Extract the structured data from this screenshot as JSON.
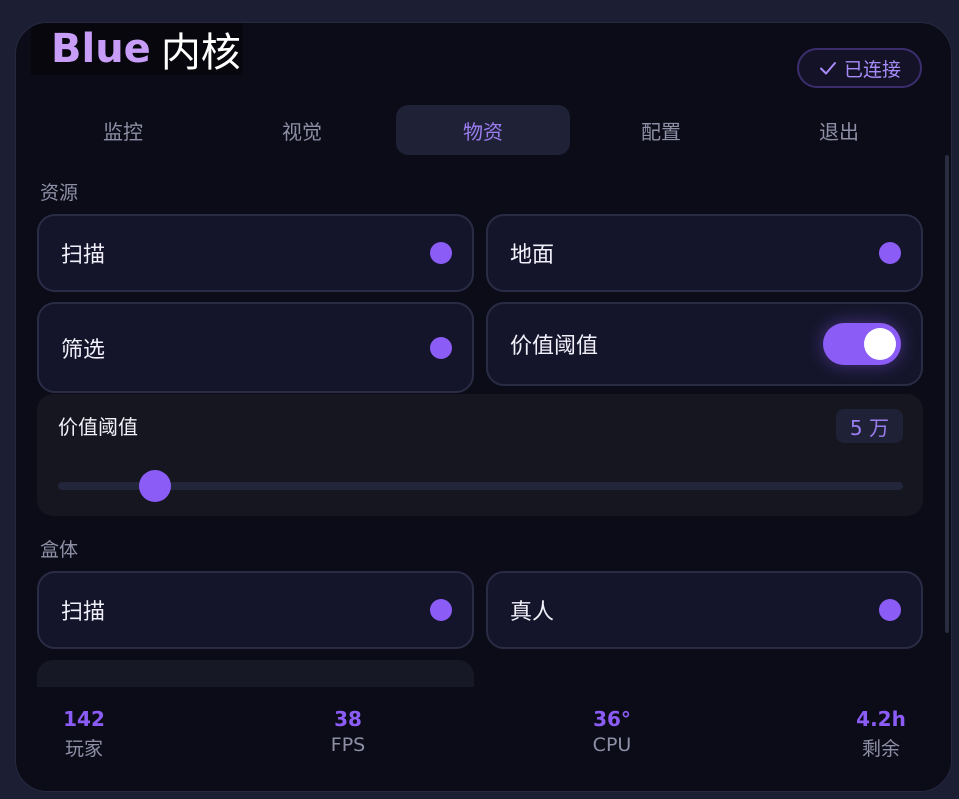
{
  "header": {
    "logo_blue": "Blue",
    "logo_core": "内核",
    "status_label": "已连接"
  },
  "tabs": [
    {
      "label": "监控"
    },
    {
      "label": "视觉"
    },
    {
      "label": "物资"
    },
    {
      "label": "配置"
    },
    {
      "label": "退出"
    }
  ],
  "active_tab": "物资",
  "resources": {
    "title": "资源",
    "scan": "扫描",
    "ground": "地面",
    "filter": "筛选",
    "value_threshold": {
      "label": "价值阈值",
      "enabled": true
    }
  },
  "threshold_slider": {
    "label": "价值阈值",
    "value_text": "5 万",
    "level": 0.115
  },
  "boxes": {
    "title": "盒体",
    "scan": "扫描",
    "real_person": "真人"
  },
  "stats": [
    {
      "value": "142",
      "label": "玩家"
    },
    {
      "value": "38",
      "label": "FPS"
    },
    {
      "value": "36°",
      "label": "CPU"
    },
    {
      "value": "4.2h",
      "label": "剩余"
    }
  ],
  "colors": {
    "accent": "#8b5cf6",
    "logo": "#c89df7",
    "panel": "#0b0c17",
    "card": "#14152a"
  },
  "icons": {
    "status": "check-icon"
  }
}
